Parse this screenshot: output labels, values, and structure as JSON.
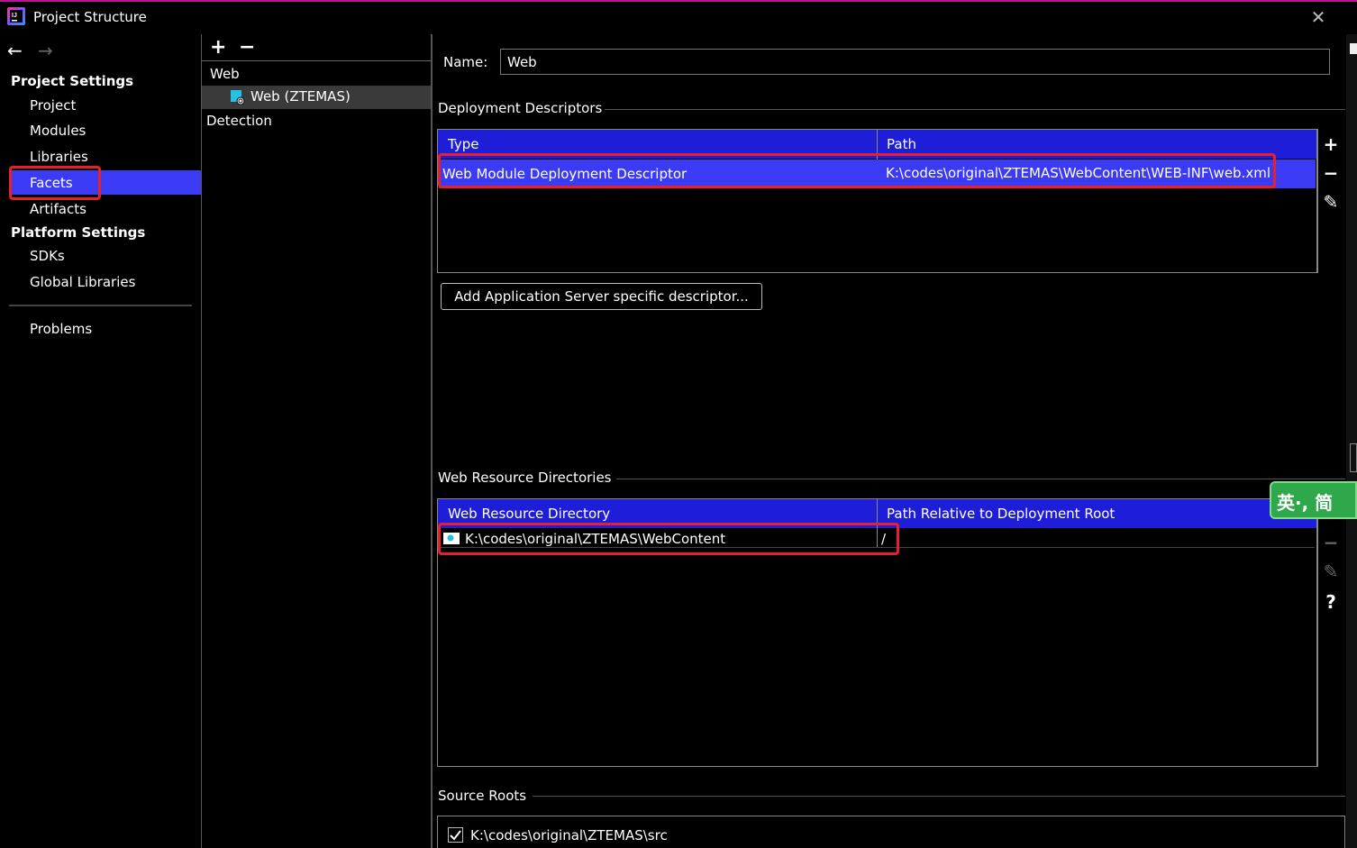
{
  "window": {
    "title": "Project Structure"
  },
  "nav": {
    "project_settings_header": "Project Settings",
    "project_settings_items": [
      "Project",
      "Modules",
      "Libraries",
      "Facets",
      "Artifacts"
    ],
    "platform_settings_header": "Platform Settings",
    "platform_settings_items": [
      "SDKs",
      "Global Libraries"
    ],
    "problems": "Problems",
    "selected": "Facets"
  },
  "facets_tree": {
    "group": "Web",
    "child": "Web (ZTEMAS)",
    "detection": "Detection"
  },
  "facet_detail": {
    "name_label": "Name:",
    "name_value": "Web",
    "deployment": {
      "title": "Deployment Descriptors",
      "col_type": "Type",
      "col_path": "Path",
      "rows": [
        {
          "type": "Web Module Deployment Descriptor",
          "path": "K:\\codes\\original\\ZTEMAS\\WebContent\\WEB-INF\\web.xml"
        }
      ],
      "add_server_button": "Add Application Server specific descriptor..."
    },
    "web_resources": {
      "title": "Web Resource Directories",
      "col_dir": "Web Resource Directory",
      "col_rel": "Path Relative to Deployment Root",
      "rows": [
        {
          "dir": "K:\\codes\\original\\ZTEMAS\\WebContent",
          "rel": "/"
        }
      ]
    },
    "source_roots": {
      "title": "Source Roots",
      "items": [
        {
          "path": "K:\\codes\\original\\ZTEMAS\\src",
          "checked": true
        }
      ]
    }
  },
  "ime": {
    "text": "英·, 简"
  }
}
